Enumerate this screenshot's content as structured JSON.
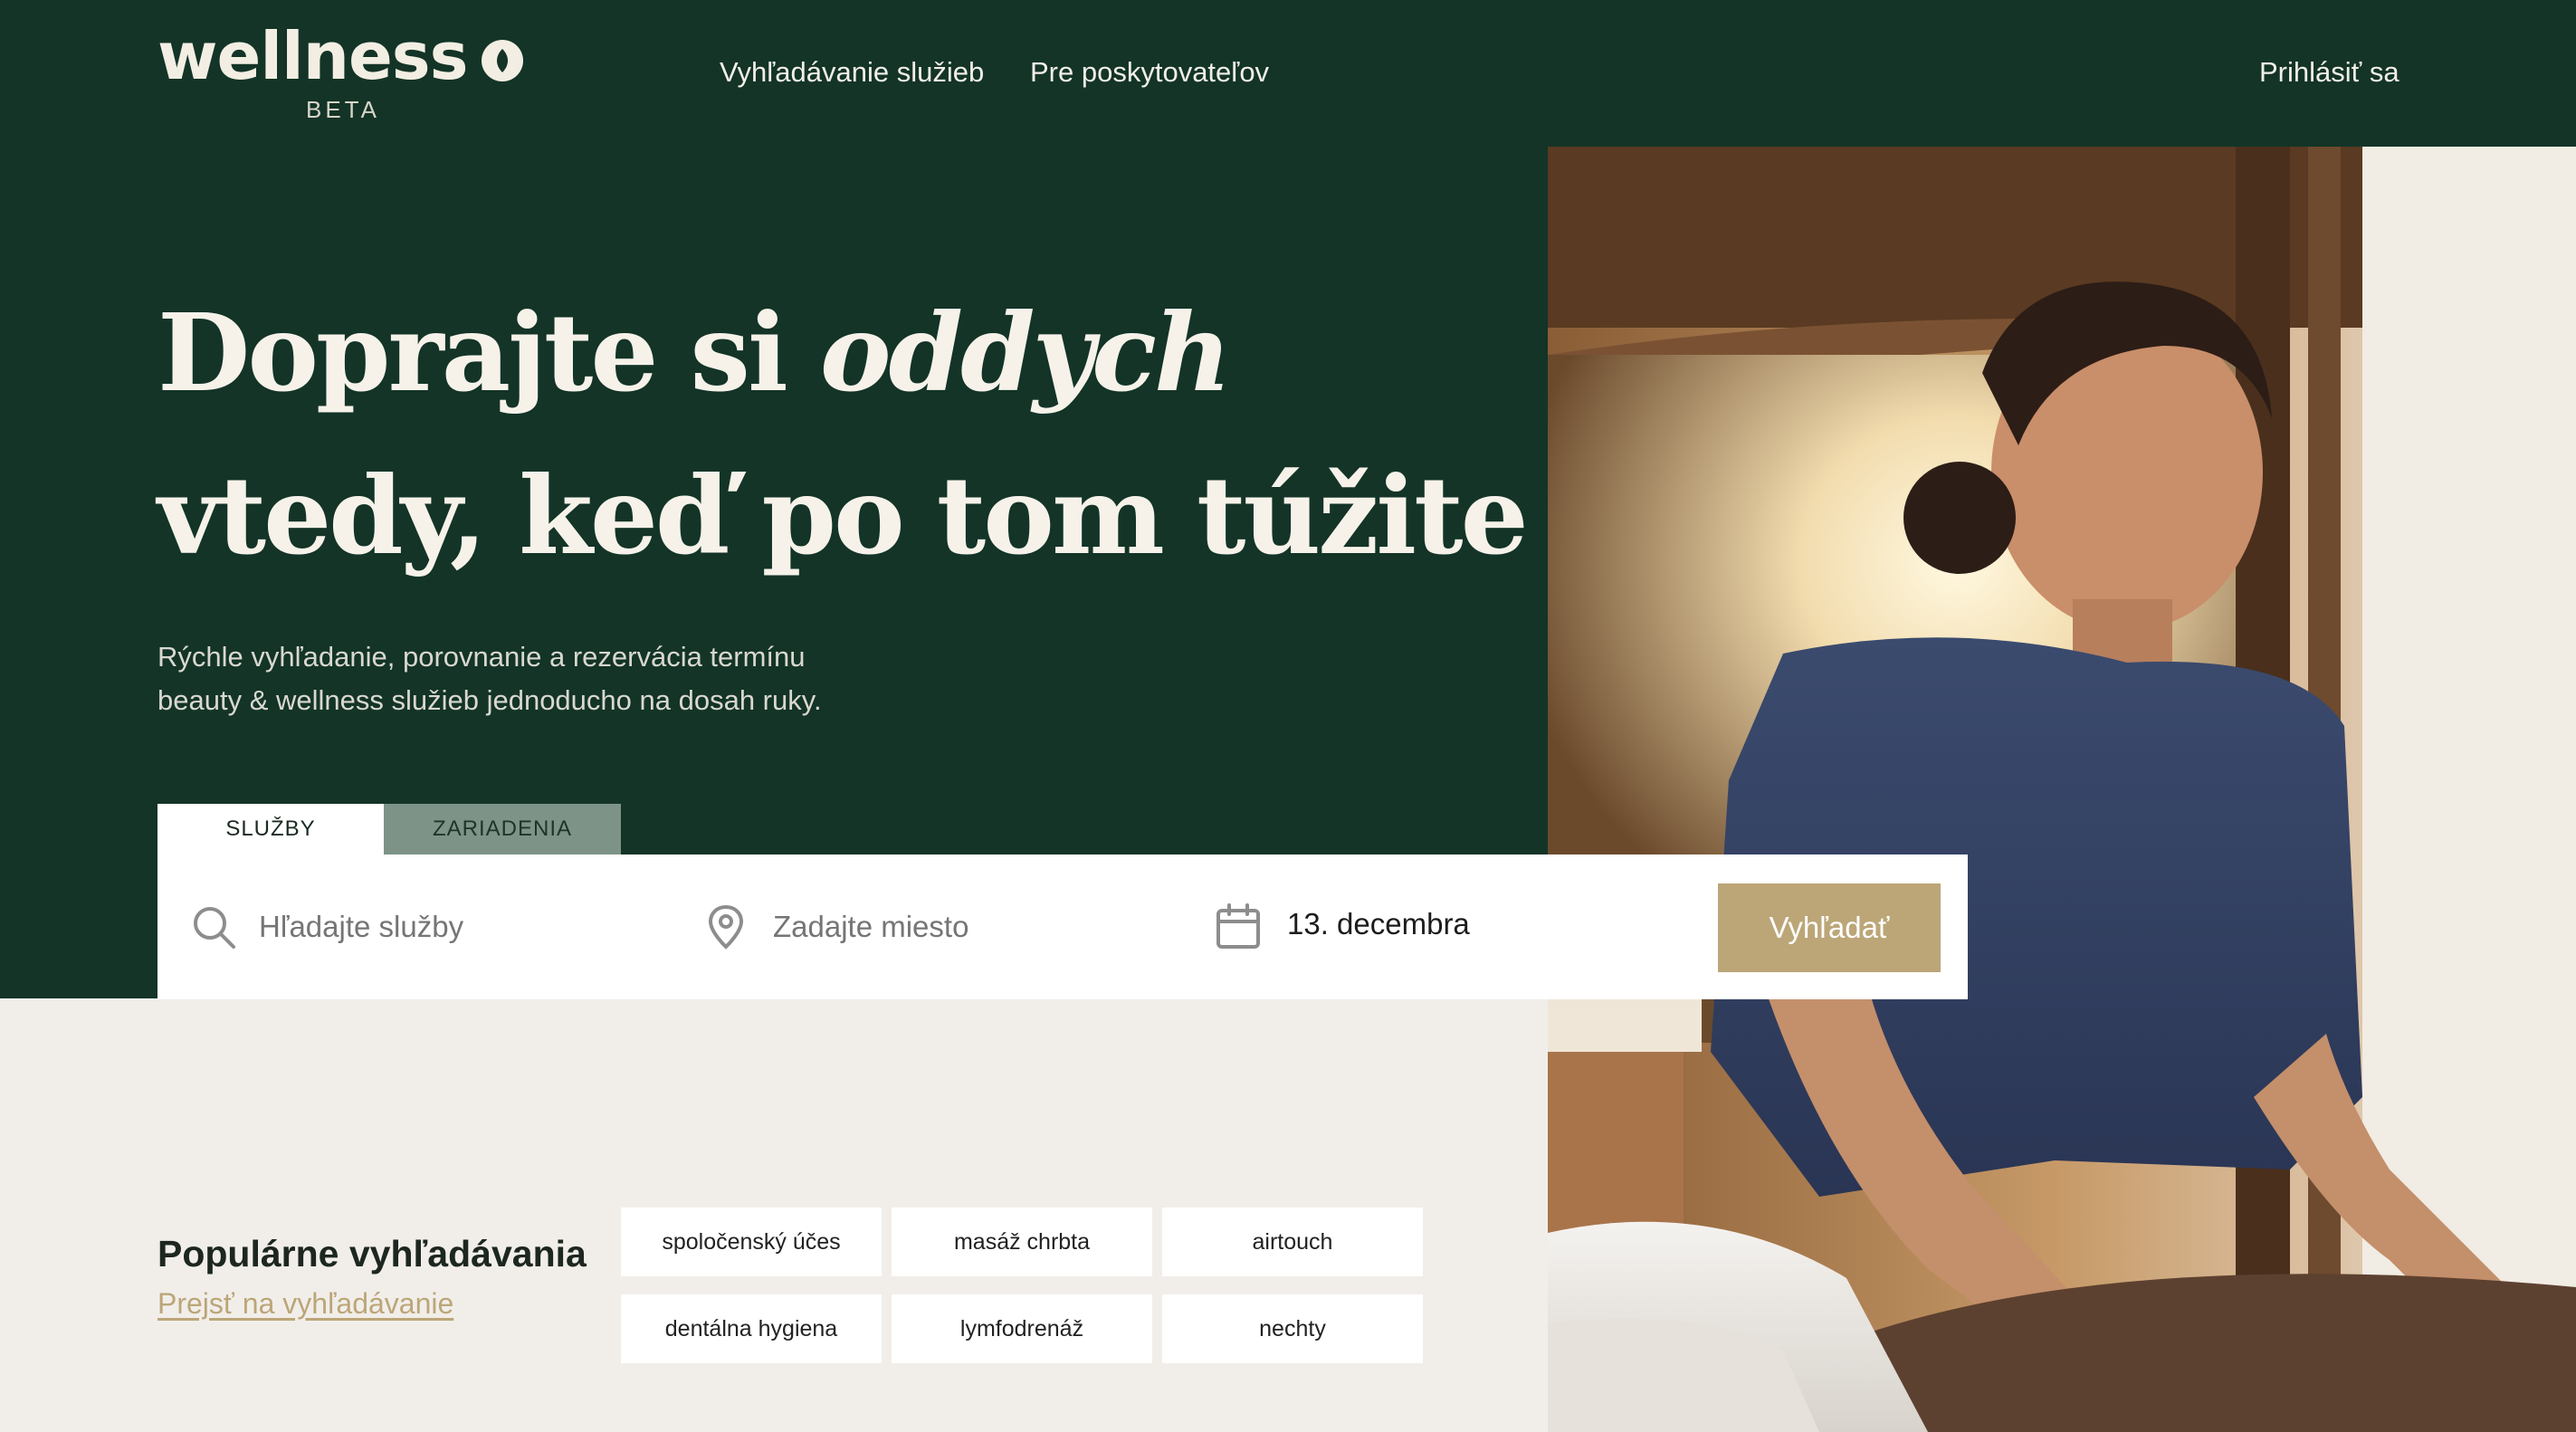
{
  "colors": {
    "hero_green": "#133427",
    "beige": "#f1eeea",
    "accent_gold": "#bca678",
    "tab_inactive": "#7d9388"
  },
  "header": {
    "logo": "wellness",
    "logo_badge": "BETA",
    "nav": {
      "search": "Vyhľadávanie služieb",
      "providers": "Pre poskytovateľov",
      "login": "Prihlásiť sa"
    }
  },
  "hero": {
    "headline_part1": "Doprajte si ",
    "headline_em": "oddych",
    "headline_part2": "vtedy, keď po tom túžite",
    "subtitle_line1": "Rýchle vyhľadanie, porovnanie a rezervácia termínu",
    "subtitle_line2": "beauty & wellness služieb jednoducho na dosah ruky."
  },
  "search": {
    "tabs": {
      "services": "SLUŽBY",
      "venues": "ZARIADENIA"
    },
    "service_placeholder": "Hľadajte služby",
    "place_placeholder": "Zadajte miesto",
    "date_value": "13. decembra",
    "button_label": "Vyhľadať",
    "icons": [
      "search-icon",
      "location-pin-icon",
      "calendar-icon"
    ]
  },
  "popular": {
    "title": "Populárne vyhľadávania",
    "link": "Prejsť na vyhľadávanie",
    "chips": [
      "spoločenský účes",
      "masáž chrbta",
      "airtouch",
      "dentálna hygiena",
      "lymfodrenáž",
      "nechty"
    ]
  }
}
